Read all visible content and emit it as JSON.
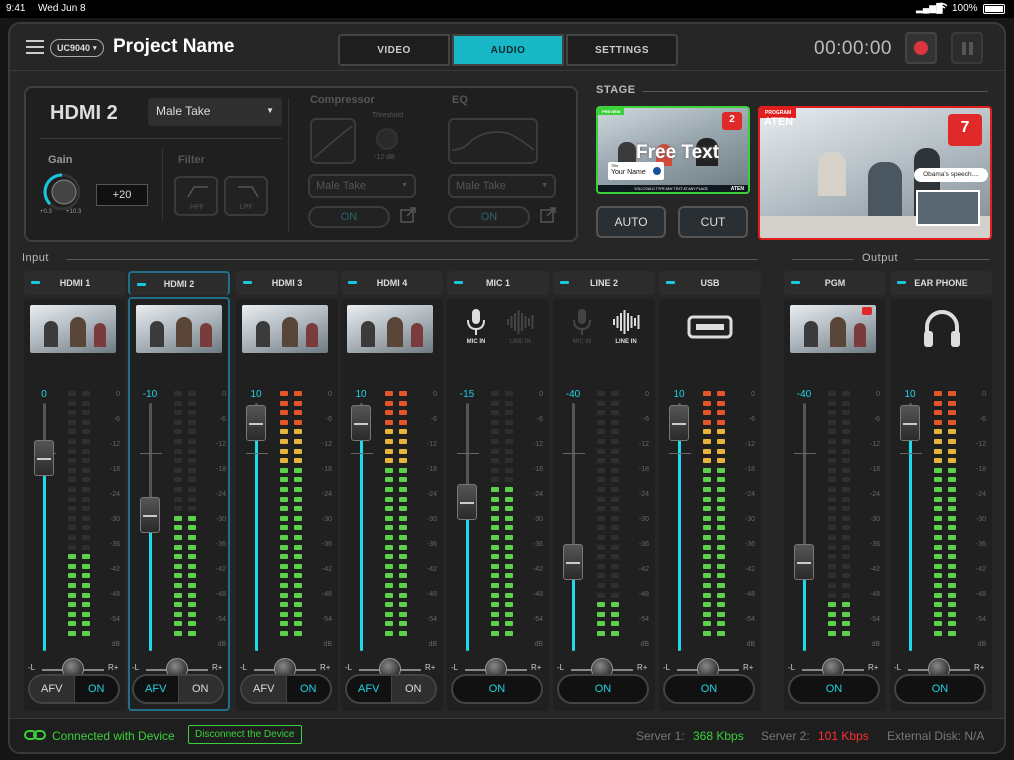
{
  "status_bar": {
    "time": "9:41",
    "date": "Wed Jun 8",
    "battery": "100%"
  },
  "header": {
    "menu_icon": "hamburger-menu-icon",
    "device": "UC9040",
    "project_name": "Project Name",
    "tabs": [
      {
        "label": "VIDEO"
      },
      {
        "label": "AUDIO",
        "active": true
      },
      {
        "label": "SETTINGS"
      }
    ],
    "timer": "00:00:00",
    "accent": "#17b7c6"
  },
  "control_panel": {
    "source": "HDMI 2",
    "preset": "Male Take",
    "gain_label": "Gain",
    "gain_value": "+20",
    "gain_min": "+0.3",
    "gain_max": "+10.3",
    "filter_label": "Filter",
    "hpf": "HPF",
    "lpf": "LPF",
    "compressor_label": "Compressor",
    "threshold_label": "Threshold",
    "threshold_value": "-12 dB",
    "comp_preset": "Male Take",
    "comp_on": "ON",
    "eq_label": "EQ",
    "eq_preset": "Male Take",
    "eq_on": "ON"
  },
  "stage": {
    "label": "STAGE",
    "preview": {
      "tag": "PREVIEW",
      "number": "2",
      "overlay_text": "Free Text",
      "title_label": "Title",
      "name": "Your Name",
      "caption": "YOU COULD TYPE ANY TEXT AT ANY PLACE",
      "brand": "ATEN"
    },
    "program": {
      "tag": "PROGRAM",
      "number": "7",
      "bubble": "Obama's speech....",
      "brand": "ATEN"
    },
    "auto": "AUTO",
    "cut": "CUT"
  },
  "sections": {
    "input": "Input",
    "output": "Output"
  },
  "scale_labels": [
    "0",
    "-6",
    "-12",
    "-18",
    "-24",
    "-30",
    "-36",
    "-42",
    "-48",
    "-54",
    "dB"
  ],
  "pan": {
    "left": "-L",
    "right": "R+"
  },
  "channels": [
    {
      "name": "HDMI 1",
      "type": "video",
      "value": "0",
      "fader_level": 0.78,
      "meter_level": 0.34,
      "mode": "afv",
      "afv": "AFV",
      "on": "ON",
      "selected_side": "afv",
      "icon": "camera-thumbnail-icon"
    },
    {
      "name": "HDMI 2",
      "type": "video",
      "value": "-10",
      "fader_level": 0.55,
      "meter_level": 0.5,
      "mode": "afv",
      "afv": "AFV",
      "on": "ON",
      "selected_side": "on",
      "selected": true,
      "icon": "camera-thumbnail-icon"
    },
    {
      "name": "HDMI 3",
      "type": "video",
      "value": "10",
      "fader_level": 0.92,
      "meter_level": 1.0,
      "mode": "afv",
      "afv": "AFV",
      "on": "ON",
      "selected_side": "afv",
      "icon": "camera-thumbnail-icon"
    },
    {
      "name": "HDMI 4",
      "type": "video",
      "value": "10",
      "fader_level": 0.92,
      "meter_level": 1.0,
      "mode": "afv",
      "afv": "AFV",
      "on": "ON",
      "selected_side": "on",
      "icon": "camera-thumbnail-icon"
    },
    {
      "name": "MIC 1",
      "type": "mic",
      "value": "-15",
      "fader_level": 0.6,
      "meter_level": 0.6,
      "mode": "on",
      "on": "ON",
      "mic_in": "MIC IN",
      "line_in": "LINE IN",
      "active_input": "mic",
      "icon": "microphone-icon"
    },
    {
      "name": "LINE 2",
      "type": "mic",
      "value": "-40",
      "fader_level": 0.36,
      "meter_level": 0.16,
      "mode": "on",
      "on": "ON",
      "mic_in": "MIC IN",
      "line_in": "LINE IN",
      "active_input": "line",
      "icon": "waveform-icon"
    },
    {
      "name": "USB",
      "type": "usb",
      "value": "10",
      "fader_level": 0.92,
      "meter_level": 1.0,
      "mode": "on",
      "on": "ON",
      "icon": "usb-icon"
    },
    {
      "name": "PGM",
      "type": "pgm",
      "value": "-40",
      "fader_level": 0.36,
      "meter_level": 0.16,
      "mode": "on",
      "on": "ON",
      "icon": "camera-thumbnail-icon"
    },
    {
      "name": "EAR PHONE",
      "type": "headphone",
      "value": "10",
      "fader_level": 0.92,
      "meter_level": 1.0,
      "mode": "on",
      "on": "ON",
      "icon": "headphones-icon"
    }
  ],
  "footer": {
    "connected": "Connected with Device",
    "disconnect": "Disconnect the Device",
    "server1_label": "Server 1:",
    "server1_value": "368 Kbps",
    "server2_label": "Server 2:",
    "server2_value": "101 Kbps",
    "disk": "External Disk: N/A",
    "good_color": "#3ad13a",
    "bad_color": "#ff3030"
  }
}
